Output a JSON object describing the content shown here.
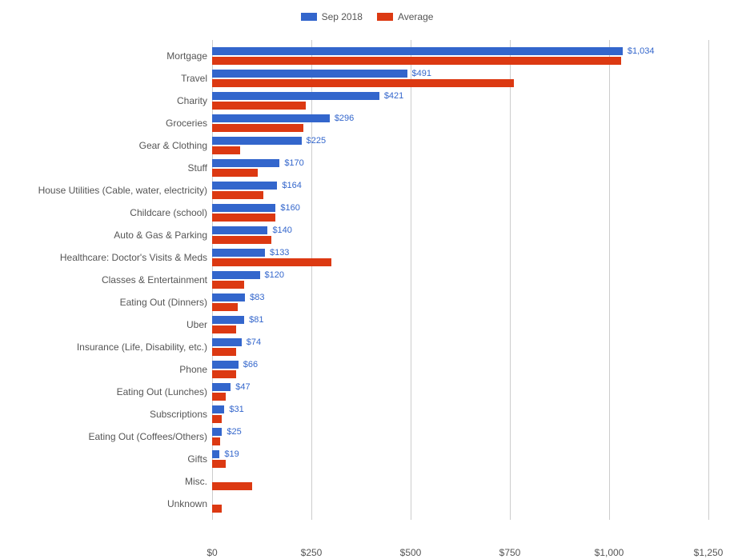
{
  "chart_data": {
    "type": "bar",
    "orientation": "horizontal",
    "categories": [
      "Mortgage",
      "Travel",
      "Charity",
      "Groceries",
      "Gear & Clothing",
      "Stuff",
      "House Utilities (Cable, water, electricity)",
      "Childcare (school)",
      "Auto & Gas & Parking",
      "Healthcare: Doctor's Visits & Meds",
      "Classes & Entertainment",
      "Eating Out (Dinners)",
      "Uber",
      "Insurance (Life, Disability, etc.)",
      "Phone",
      "Eating Out (Lunches)",
      "Subscriptions",
      "Eating Out (Coffees/Others)",
      "Gifts",
      "Misc.",
      "Unknown"
    ],
    "series": [
      {
        "name": "Sep 2018",
        "color": "#3366cc",
        "values": [
          1034,
          491,
          421,
          296,
          225,
          170,
          164,
          160,
          140,
          133,
          120,
          83,
          81,
          74,
          66,
          47,
          31,
          25,
          19,
          0,
          0
        ],
        "value_labels": [
          "$1,034",
          "$491",
          "$421",
          "$296",
          "$225",
          "$170",
          "$164",
          "$160",
          "$140",
          "$133",
          "$120",
          "$83",
          "$81",
          "$74",
          "$66",
          "$47",
          "$31",
          "$25",
          "$19",
          "",
          ""
        ]
      },
      {
        "name": "Average",
        "color": "#dc3912",
        "values": [
          1030,
          760,
          235,
          230,
          70,
          115,
          130,
          160,
          150,
          300,
          80,
          65,
          60,
          60,
          60,
          35,
          25,
          20,
          35,
          100,
          25
        ]
      }
    ],
    "xlim": [
      0,
      1250
    ],
    "xticks": [
      0,
      250,
      500,
      750,
      1000,
      1250
    ],
    "xtick_labels": [
      "$0",
      "$250",
      "$500",
      "$750",
      "$1,000",
      "$1,250"
    ],
    "xlabel": "",
    "ylabel": "",
    "title": ""
  }
}
